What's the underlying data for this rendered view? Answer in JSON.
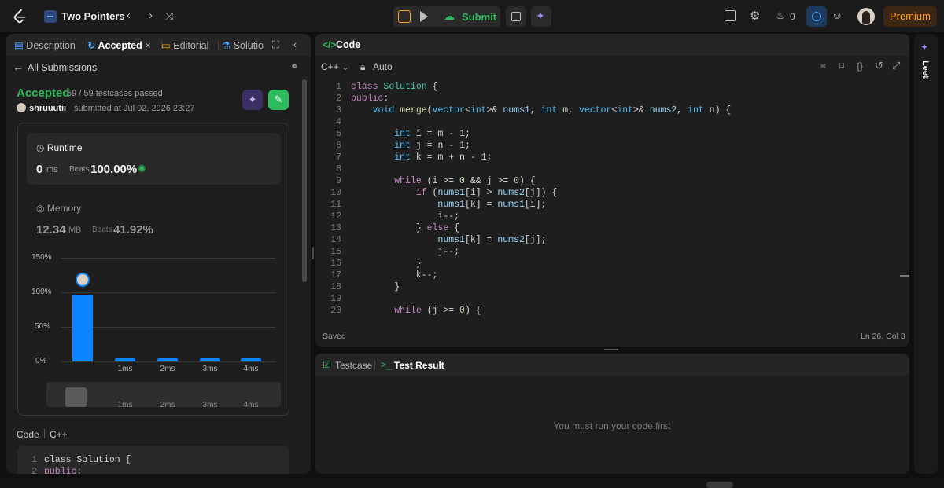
{
  "header": {
    "title": "Two Pointers",
    "submit_label": "Submit",
    "streak_count": "0",
    "premium_label": "Premium"
  },
  "left": {
    "tabs": [
      "Description",
      "Accepted",
      "Editorial",
      "Solutio"
    ],
    "back_label": "All Submissions",
    "status": "Accepted",
    "testcases": "59 / 59 testcases passed",
    "user": "shruuutii",
    "submitted": "submitted at Jul 02, 2026 23:27",
    "runtime": {
      "label": "Runtime",
      "value": "0",
      "unit": "ms",
      "beats_label": "Beats",
      "beats": "100.00%"
    },
    "memory": {
      "label": "Memory",
      "value": "12.34",
      "unit": "MB",
      "beats_label": "Beats",
      "beats": "41.92%"
    },
    "code_label": "Code",
    "lang_label": "C++",
    "snippet": [
      "class Solution {",
      "public:"
    ]
  },
  "chart_data": {
    "type": "bar",
    "categories": [
      "",
      "1ms",
      "2ms",
      "3ms",
      "4ms"
    ],
    "values": [
      97,
      4,
      4,
      4,
      4
    ],
    "yticks": [
      "150%",
      "100%",
      "50%",
      "0%"
    ],
    "ylim": [
      0,
      150
    ],
    "accent": "#0a84ff"
  },
  "editor": {
    "title": "Code",
    "lang": "C++",
    "mode": "Auto",
    "saved": "Saved",
    "cursor": "Ln 26, Col 3",
    "lines": [
      "class Solution {",
      "public:",
      "    void merge(vector<int>& nums1, int m, vector<int>& nums2, int n) {",
      "",
      "        int i = m - 1;",
      "        int j = n - 1;",
      "        int k = m + n - 1;",
      "",
      "        while (i >= 0 && j >= 0) {",
      "            if (nums1[i] > nums2[j]) {",
      "                nums1[k] = nums1[i];",
      "                i--;",
      "            } else {",
      "                nums1[k] = nums2[j];",
      "                j--;",
      "            }",
      "            k--;",
      "        }",
      "",
      "        while (j >= 0) {"
    ]
  },
  "bottom": {
    "testcase_tab": "Testcase",
    "result_tab": "Test Result",
    "message": "You must run your code first"
  },
  "side_label": "Leet"
}
